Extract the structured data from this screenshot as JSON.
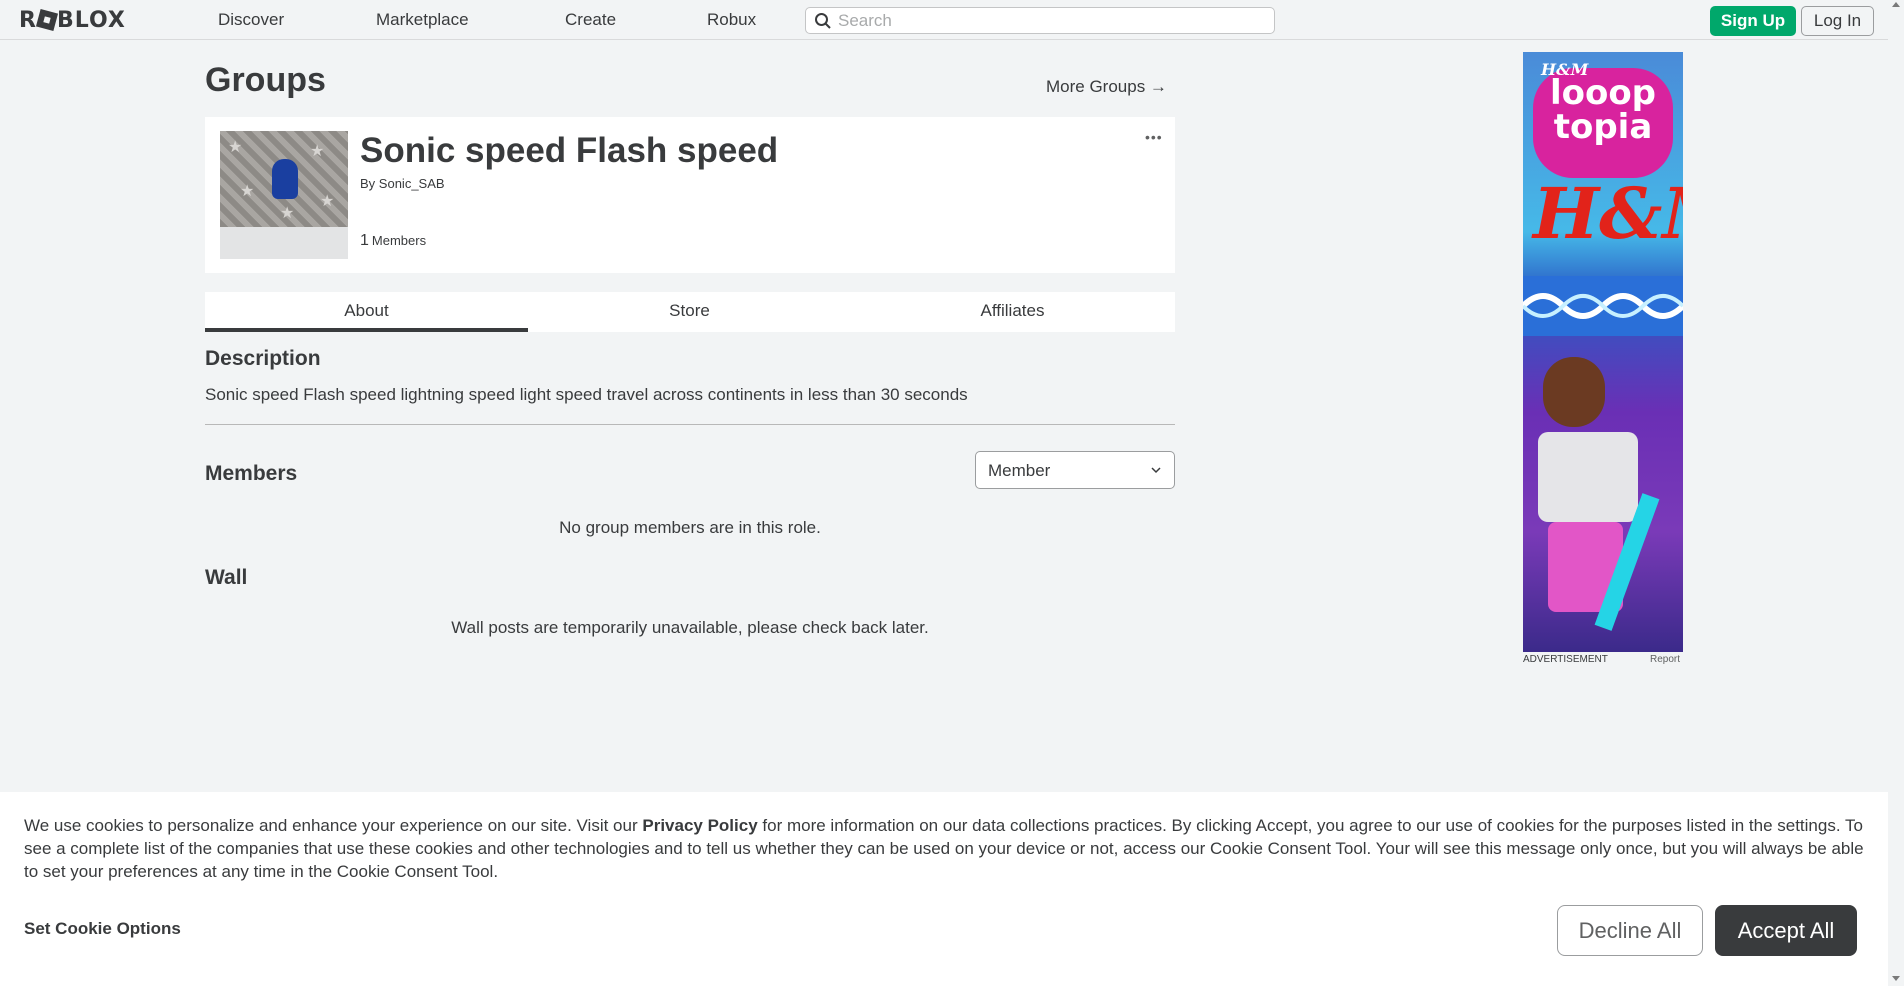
{
  "nav": {
    "logo": "ROBLOX",
    "links": [
      "Discover",
      "Marketplace",
      "Create",
      "Robux"
    ],
    "search_placeholder": "Search",
    "signup_label": "Sign Up",
    "login_label": "Log In"
  },
  "page": {
    "title": "Groups",
    "more_groups": "More Groups →"
  },
  "group": {
    "name": "Sonic speed Flash speed",
    "by_prefix": "By",
    "owner": "Sonic_SAB",
    "member_count": "1",
    "member_label": "Members",
    "more_menu": "•••"
  },
  "tabs": [
    {
      "label": "About",
      "active": true
    },
    {
      "label": "Store",
      "active": false
    },
    {
      "label": "Affiliates",
      "active": false
    }
  ],
  "about": {
    "description_title": "Description",
    "description": "Sonic speed Flash speed lightning speed light speed travel across continents in less than 30 seconds",
    "members_title": "Members",
    "role_selected": "Member",
    "members_empty": "No group members are in this role.",
    "wall_title": "Wall",
    "wall_empty": "Wall posts are temporarily unavailable, please check back later."
  },
  "ad": {
    "hm_small": "H&M",
    "brand_text": "looop topia",
    "hm_big": "H&M",
    "label": "ADVERTISEMENT",
    "report": "Report"
  },
  "cookie": {
    "text_before": "We use cookies to personalize and enhance your experience on our site. Visit our ",
    "privacy_link": "Privacy Policy",
    "text_after": " for more information on our data collections practices. By clicking Accept, you agree to our use of cookies for the purposes listed in the settings. To see a complete list of the companies that use these cookies and other technologies and to tell us whether they can be used on your device or not, access our Cookie Consent Tool. Your will see this message only once, but you will always be able to set your preferences at any time in the Cookie Consent Tool.",
    "options_label": "Set Cookie Options",
    "decline_label": "Decline All",
    "accept_label": "Accept All"
  },
  "colors": {
    "signup_green": "#00a86b",
    "accept_dark": "#393b3d",
    "page_bg": "#f2f4f5"
  }
}
